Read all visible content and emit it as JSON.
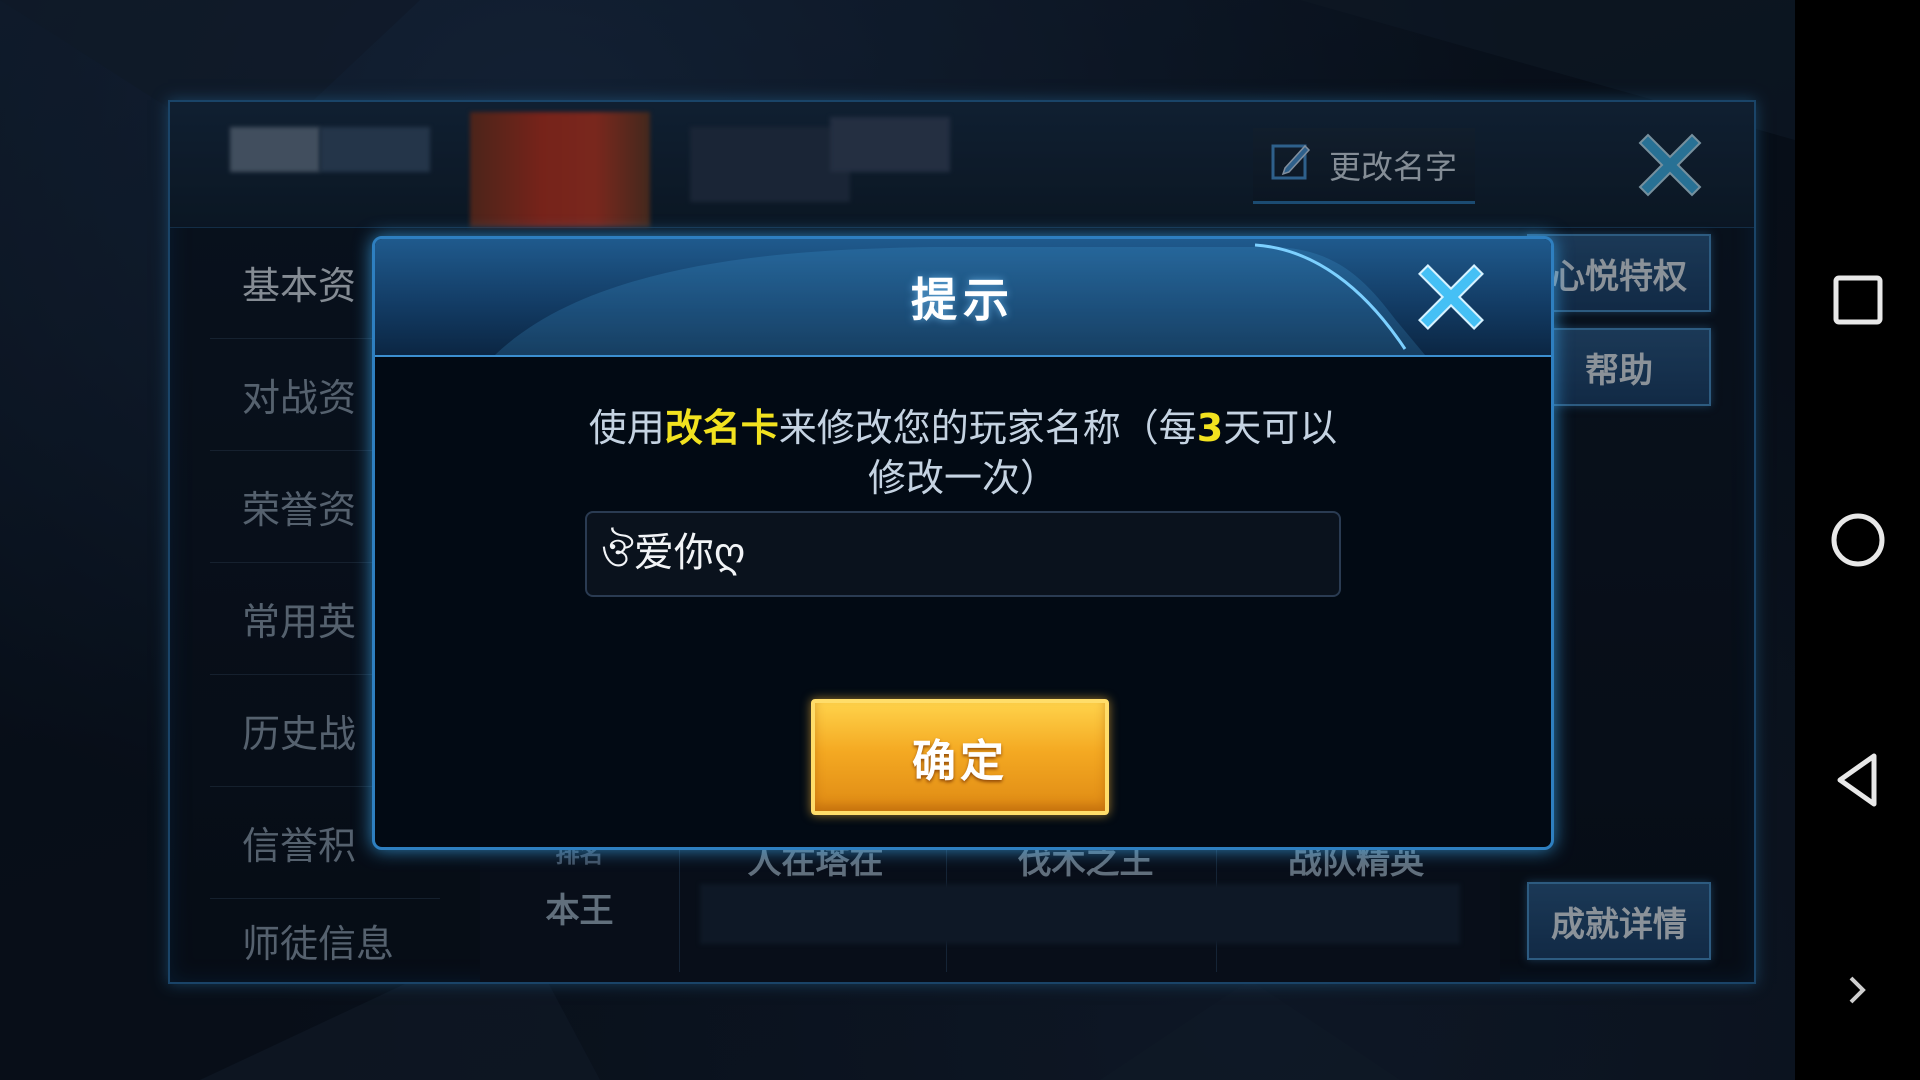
{
  "panel": {
    "rename_label": "更改名字",
    "side_menu": [
      "基本资",
      "对战资",
      "荣誉资",
      "常用英",
      "历史战",
      "信誉积",
      "师徒信息"
    ],
    "right_buttons": [
      "心悦特权",
      "帮助",
      "成就详情"
    ],
    "tabs": [
      "人在塔在",
      "伐木之王",
      "战队精英"
    ],
    "partial_texts": {
      "rank": "本王",
      "rank_label": "排名"
    }
  },
  "dialog": {
    "title": "提示",
    "message_prefix": "使用",
    "message_highlight": "改名卡",
    "message_middle": "来修改您的玩家名称（每",
    "message_number": "3",
    "message_suffix": "天可以修改一次）",
    "input_value": "ঔ爱你ღ",
    "confirm_label": "确定"
  },
  "colors": {
    "highlight": "#f2e21f",
    "confirm_gold": "#f4a922",
    "frame_blue": "#2e7fc0"
  },
  "icons": [
    "edit-icon",
    "close-icon",
    "recent-apps-icon",
    "home-icon",
    "back-icon",
    "expand-arrow-icon"
  ]
}
